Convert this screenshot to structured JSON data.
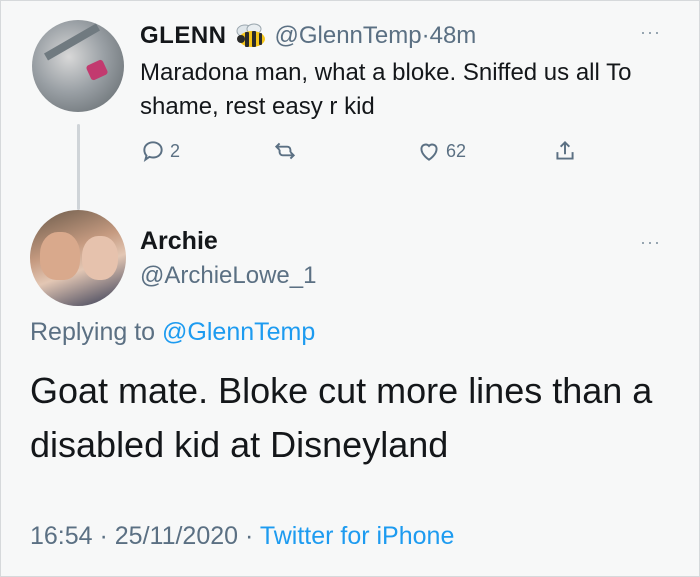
{
  "tweet": {
    "display_name": "GLENN",
    "name_emoji": "bee-emoji",
    "handle": "@GlennTemp",
    "separator": " · ",
    "time": "48m",
    "more": "···",
    "text": "Maradona man, what a bloke. Sniffed us all To shame, rest easy r kid",
    "actions": {
      "reply_count": "2",
      "retweet_count": "",
      "like_count": "62"
    },
    "icons": [
      "reply-icon",
      "retweet-icon",
      "like-icon",
      "share-icon"
    ]
  },
  "reply": {
    "display_name": "Archie",
    "handle": "@ArchieLowe_1",
    "more": "···",
    "replying_prefix": "Replying to ",
    "replying_to": "@GlennTemp",
    "text": "Goat mate. Bloke cut more lines than a disabled kid at Disneyland",
    "timestamp": "16:54 · 25/11/2020 · ",
    "source": "Twitter for iPhone"
  },
  "colors": {
    "secondary_text": "#5b7083",
    "link": "#1d9bf0",
    "primary_text": "#14171a"
  }
}
